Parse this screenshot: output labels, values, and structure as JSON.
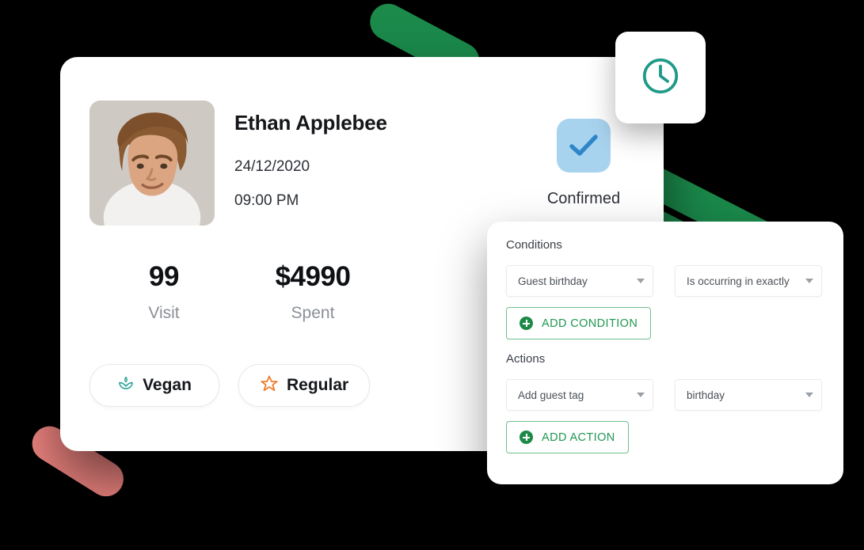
{
  "colors": {
    "background": "#000000",
    "green_accent": "#1B8A4B",
    "pink_accent": "#EE8480",
    "teal_icon": "#1F9A8A",
    "check_blue_bg": "#A8D3EF",
    "check_blue_mark": "#2E86C8",
    "star_orange": "#EF7E2E",
    "card_white": "#FFFFFF",
    "muted_text": "#8B8F96"
  },
  "guest_card": {
    "avatar_alt": "avatar-photo",
    "name": "Ethan Applebee",
    "date": "24/12/2020",
    "time": "09:00 PM",
    "status": {
      "icon": "check-icon",
      "label": "Confirmed"
    },
    "stats": [
      {
        "value": "99",
        "label": "Visit"
      },
      {
        "value": "$4990",
        "label": "Spent"
      }
    ],
    "tags": [
      {
        "icon": "leaf-icon",
        "label": "Vegan"
      },
      {
        "icon": "star-icon",
        "label": "Regular"
      }
    ]
  },
  "clock_chip": {
    "icon": "clock-icon"
  },
  "rules_panel": {
    "conditions": {
      "title": "Conditions",
      "fields": [
        {
          "value": "Guest birthday"
        },
        {
          "value": "Is occurring in exactly"
        }
      ],
      "add_button": {
        "icon": "plus-circle-icon",
        "label": "ADD CONDITION"
      }
    },
    "actions": {
      "title": "Actions",
      "fields": [
        {
          "value": "Add guest tag"
        },
        {
          "value": "birthday"
        }
      ],
      "add_button": {
        "icon": "plus-circle-icon",
        "label": "ADD ACTION"
      }
    }
  }
}
